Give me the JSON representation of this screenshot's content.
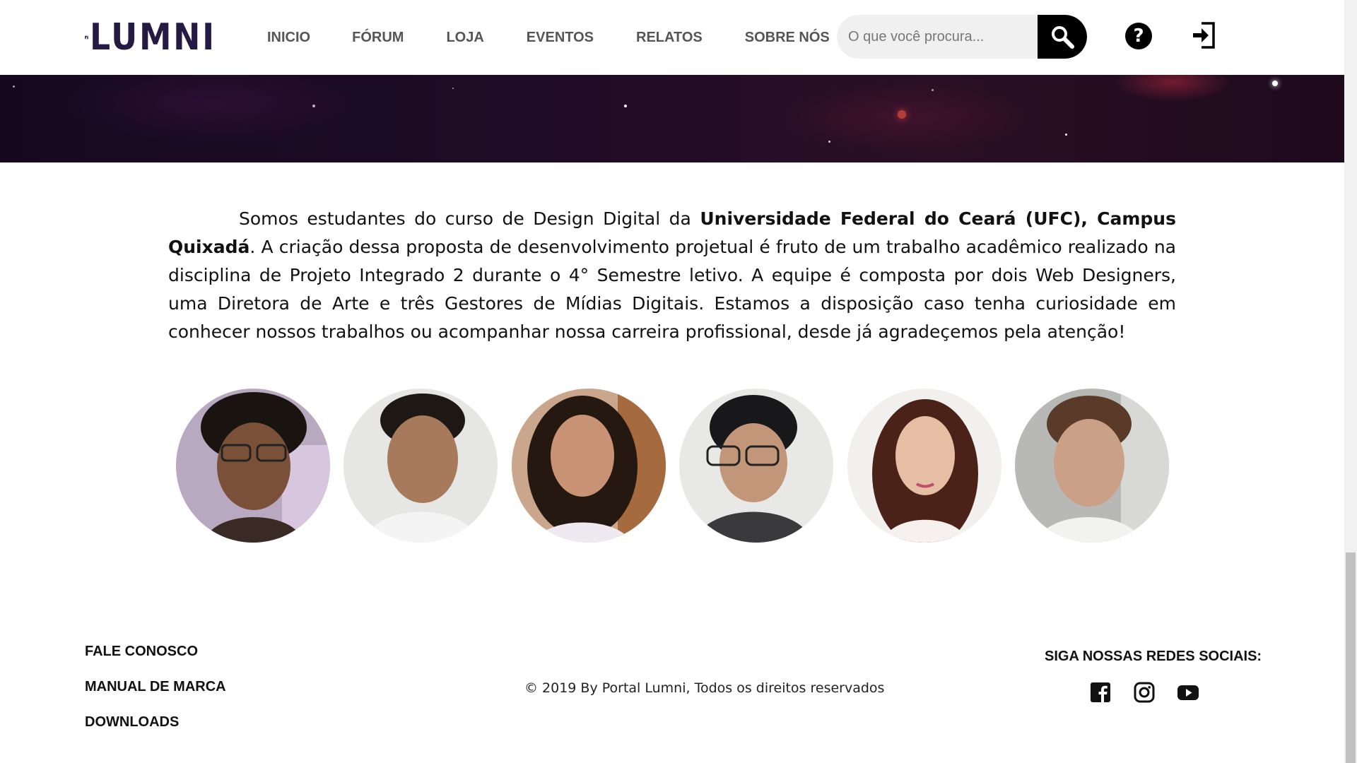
{
  "header": {
    "logo_text": "LUMNI",
    "nav": [
      {
        "label": "INICIO"
      },
      {
        "label": "FÓRUM"
      },
      {
        "label": "LOJA"
      },
      {
        "label": "EVENTOS"
      },
      {
        "label": "RELATOS"
      },
      {
        "label": "SOBRE NÓS"
      }
    ],
    "search": {
      "placeholder": "O que você procura...",
      "icon": "search-icon"
    },
    "help": {
      "label": "?",
      "icon": "help-icon"
    },
    "login": {
      "icon": "login-icon"
    }
  },
  "intro": {
    "text_before": "Somos estudantes do curso de Design Digital da ",
    "bold": "Universidade Federal do Ceará (UFC), Campus Quixadá",
    "text_after": ". A criação dessa proposta de desenvolvimento projetual é fruto de um trabalho acadêmico realizado na disciplina de Projeto Integrado 2 durante o 4° Semestre letivo. A equipe é composta por dois Web Designers, uma Diretora de Arte e três Gestores de Mídias Digitais. Estamos a disposição caso tenha curiosidade em conhecer nossos trabalhos ou acompanhar nossa carreira profissional, desde já agradeçemos pela atenção!"
  },
  "team": {
    "count": 6
  },
  "footer": {
    "links": [
      {
        "label": "FALE CONOSCO"
      },
      {
        "label": "MANUAL DE MARCA"
      },
      {
        "label": "DOWNLOADS"
      }
    ],
    "copyright": "© 2019 By Portal Lumni, Todos os direitos reservados",
    "social_title": "SIGA NOSSAS REDES SOCIAIS:",
    "social_icons": [
      "facebook-icon",
      "instagram-icon",
      "youtube-icon"
    ]
  },
  "colors": {
    "brand": "#241a44",
    "banner": "#1f0c26",
    "search_bg": "#f0f0f0",
    "text": "#111111"
  }
}
